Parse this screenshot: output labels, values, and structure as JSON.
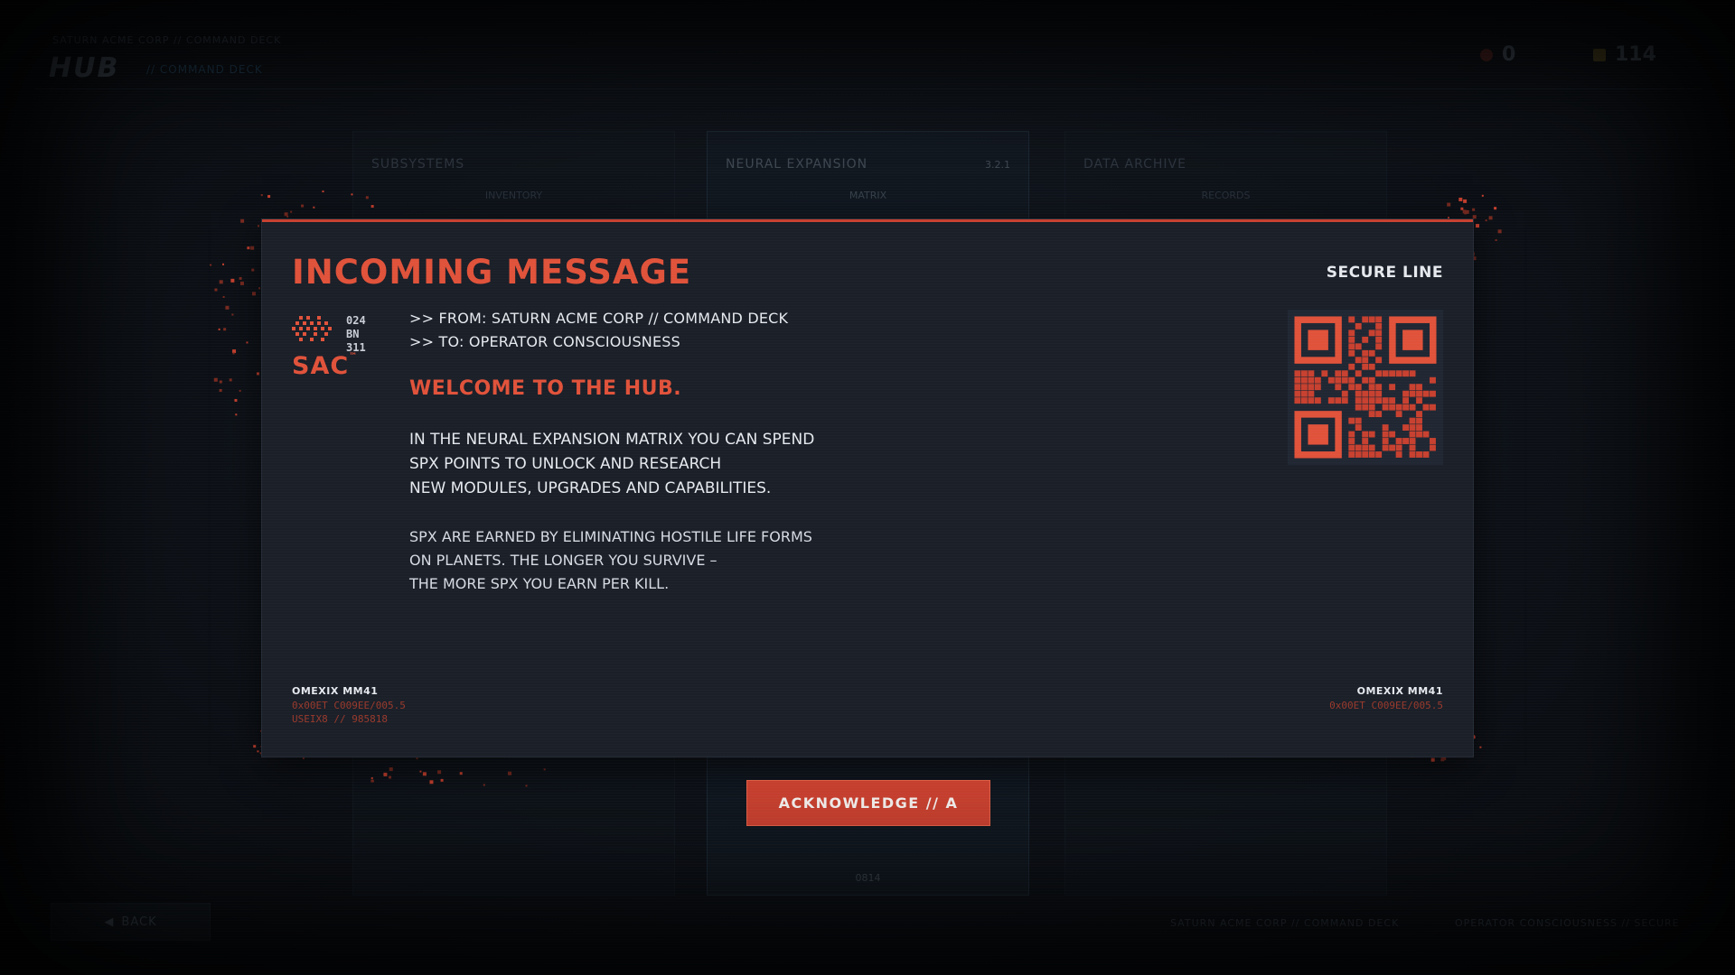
{
  "topbar": {
    "breadcrumb": "SATURN ACME CORP // COMMAND DECK",
    "title": "HUB",
    "subtitle": "// COMMAND DECK",
    "currency_red": "0",
    "currency_gold": "114"
  },
  "background_cards": [
    {
      "title": "SUBSYSTEMS",
      "meta": "",
      "sub": "INVENTORY",
      "foot": ""
    },
    {
      "title": "NEURAL EXPANSION",
      "meta": "3.2.1",
      "sub": "MATRIX",
      "foot": "0814"
    },
    {
      "title": "DATA ARCHIVE",
      "meta": "",
      "sub": "RECORDS",
      "foot": ""
    }
  ],
  "back_button": {
    "label": "BACK"
  },
  "footer": {
    "left": "SATURN ACME CORP // COMMAND DECK",
    "right": "OPERATOR CONSCIOUSNESS // SECURE"
  },
  "modal": {
    "title": "INCOMING MESSAGE",
    "secure_label": "SECURE LINE",
    "logo": {
      "text": "SAC",
      "code_lines": [
        "024",
        "BN",
        "311"
      ]
    },
    "from_line": ">> FROM: SATURN ACME CORP // COMMAND DECK",
    "to_line": ">> TO: OPERATOR CONSCIOUSNESS",
    "welcome": "WELCOME TO THE HUB.",
    "paragraph1": [
      "IN THE NEURAL EXPANSION MATRIX YOU CAN SPEND",
      "SPX POINTS TO UNLOCK AND RESEARCH",
      "NEW MODULES, UPGRADES AND CAPABILITIES."
    ],
    "paragraph2": [
      "SPX ARE EARNED BY ELIMINATING HOSTILE LIFE FORMS",
      "ON PLANETS. THE LONGER YOU SURVIVE –",
      "THE MORE SPX YOU EARN PER KILL."
    ],
    "corner_left": {
      "title": "OMEXIX MM41",
      "code1": "0x00ET C009EE/005.5",
      "code2": "USEIX8 // 985818"
    },
    "corner_right": {
      "title": "OMEXIX MM41",
      "code1": "0x00ET C009EE/005.5"
    }
  },
  "acknowledge": {
    "label": "ACKNOWLEDGE // A"
  },
  "colors": {
    "accent": "#e0523a",
    "button": "#c8402f",
    "panel": "#1a1f28",
    "text": "#e6e9ee"
  }
}
